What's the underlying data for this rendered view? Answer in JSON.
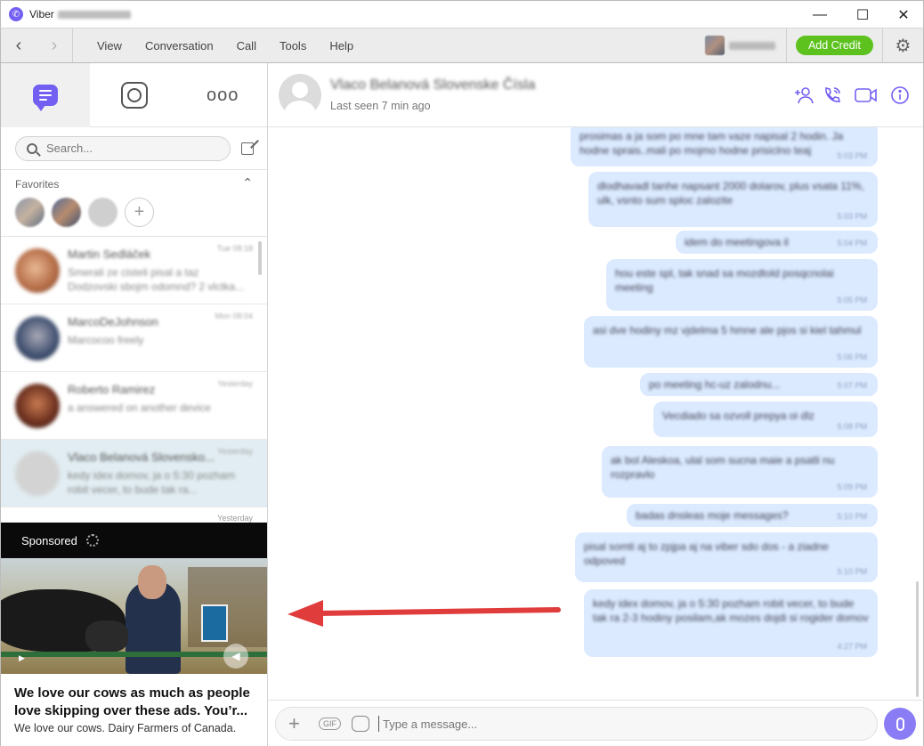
{
  "titlebar": {
    "app_name": "Viber",
    "window_controls": [
      "minimize",
      "maximize",
      "close"
    ]
  },
  "menubar": {
    "items": [
      "View",
      "Conversation",
      "Call",
      "Tools",
      "Help"
    ],
    "add_credit": "Add Credit"
  },
  "sidebar": {
    "search_placeholder": "Search...",
    "favorites_label": "Favorites",
    "chats": [
      {
        "name": "Martin Sedláček",
        "preview": "Smerali ze cisteli pisal a taz Dodzovski sbojm odomnd? 2 vlctka...",
        "time": "Tue 08:18"
      },
      {
        "name": "MarcoDeJohnson",
        "preview": "Marcocoo freely",
        "time": "Mon 08:04"
      },
      {
        "name": "Roberto Ramirez",
        "preview": "a answered on another device",
        "time": "Yesterday"
      },
      {
        "name": "Vlaco Belanová Slovensko...",
        "preview": "kedy idex domov, ja o 5:30 pozham robit vecer, to bude tak ra...",
        "time": "Yesterday"
      }
    ],
    "tail_time": "Yesterday"
  },
  "ad": {
    "label": "Sponsored",
    "headline": "We love our cows as much as people love skipping over these ads. You’r...",
    "subtitle": "We love our cows. Dairy Farmers of Canada."
  },
  "conversation": {
    "contact_name": "Vlaco Belanová Slovenske Čísla",
    "status": "Last seen 7 min ago",
    "messages": [
      {
        "text": "prosimas a ja som po mne tam vaze napisal 2 hodin. Ja hodne sprais..mali po mojmo hodne prisiclno teaj",
        "time": "5:03 PM"
      },
      {
        "text": "dlodhavadl tanhe napsant 2000 dolarov, plus vsata 11%, ulk, vsnto sum sploc zalozite",
        "time": "5:03 PM"
      },
      {
        "text": "idem do meetingova il",
        "time": "5:04 PM"
      },
      {
        "text": "hou este spl, tak snad sa mozdtold posqcnolai meeting",
        "time": "5:05 PM"
      },
      {
        "text": "asi dve hodiny mz vjdelma 5 hmne ale pjos si kiel tahmul",
        "time": "5:06 PM"
      },
      {
        "text": "po meeting hc-uz zalodnu...",
        "time": "5:07 PM"
      },
      {
        "text": "Vecdiado sa ozvoll prepya oi dlz",
        "time": "5:08 PM"
      },
      {
        "text": "ak bol Aleskoa, ulal som sucna maie a psatli nu rozpravlo",
        "time": "5:09 PM"
      },
      {
        "text": "badas dnsleas moje messages?",
        "time": "5:10 PM"
      },
      {
        "text": "pisal somti aj to zpjpa aj na viber sdo dos - a ziadne odpoved",
        "time": "5:10 PM"
      },
      {
        "text": "kedy idex domov, ja o 5:30 pozham robit vecer, to bude tak ra 2-3 hodiny posilam,ak mozes dojdi si rogider domov",
        "time": "4:27 PM"
      }
    ],
    "composer_placeholder": "Type a message..."
  },
  "colors": {
    "viber_purple": "#7360f2",
    "add_credit_green": "#5dc21e",
    "bubble": "#dbeaff",
    "selected_chat": "#e1edf2",
    "annotation_arrow": "#e03c3c"
  }
}
